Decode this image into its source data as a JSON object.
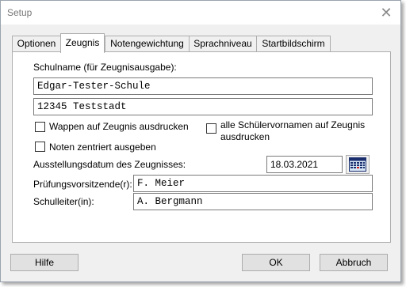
{
  "window": {
    "title": "Setup"
  },
  "tabs": [
    {
      "label": "Optionen"
    },
    {
      "label": "Zeugnis"
    },
    {
      "label": "Notengewichtung"
    },
    {
      "label": "Sprachniveau"
    },
    {
      "label": "Startbildschirm"
    }
  ],
  "zeugnis": {
    "schoolname_label": "Schulname (für Zeugnisausgabe):",
    "schoolname_line1": "Edgar-Tester-Schule",
    "schoolname_line2": "12345 Teststadt",
    "checkbox_wappen": {
      "label": "Wappen auf Zeugnis ausdrucken",
      "checked": false
    },
    "checkbox_vornamen": {
      "label_line1": "alle Schülervornamen auf Zeugnis",
      "label_line2": "ausdrucken",
      "checked": false
    },
    "checkbox_noten": {
      "label": "Noten zentriert ausgeben",
      "checked": false
    },
    "date_label": "Ausstellungsdatum des Zeugnisses:",
    "date_value": "18.03.2021",
    "chair_label": "Prüfungsvorsitzende(r):",
    "chair_value": "F. Meier",
    "principal_label": "Schulleiter(in):",
    "principal_value": "A. Bergmann"
  },
  "buttons": {
    "help": "Hilfe",
    "ok": "OK",
    "cancel": "Abbruch"
  },
  "icons": {
    "close": "close-icon",
    "calendar": "calendar-icon"
  }
}
